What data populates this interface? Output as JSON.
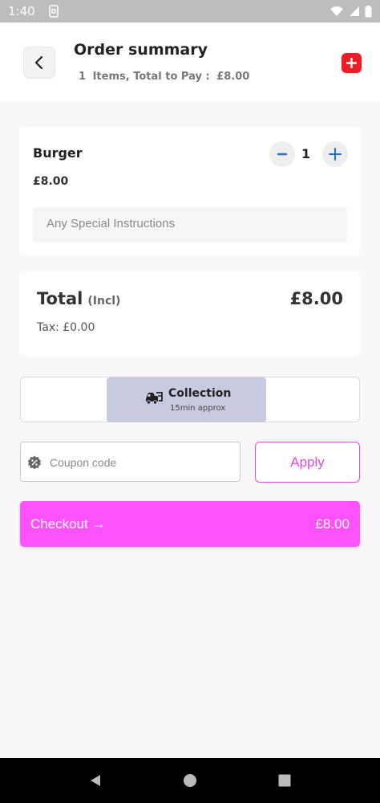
{
  "status_bar": {
    "time": "1:40"
  },
  "header": {
    "title": "Order summary",
    "item_count": "1",
    "items_text": "Items, Total to Pay :",
    "total_to_pay": "£8.00"
  },
  "cart": {
    "items": [
      {
        "name": "Burger",
        "price": "£8.00",
        "quantity": "1",
        "minus_label": "–",
        "plus_label": "+"
      }
    ],
    "instructions_placeholder": "Any Special Instructions"
  },
  "totals": {
    "label": "Total",
    "incl": "(Incl)",
    "amount": "£8.00",
    "tax": "Tax: £0.00"
  },
  "delivery": {
    "mode_title": "Collection",
    "mode_sub": "15min approx"
  },
  "coupon": {
    "placeholder": "Coupon code",
    "apply_label": "Apply"
  },
  "checkout": {
    "label": "Checkout →",
    "amount": "£8.00"
  },
  "colors": {
    "accent": "#ff52ff",
    "apply_border": "#e04be0",
    "add_button": "#ee1c24",
    "collection_bg": "#c8cae0",
    "plus_icon": "#1e6fd9"
  }
}
